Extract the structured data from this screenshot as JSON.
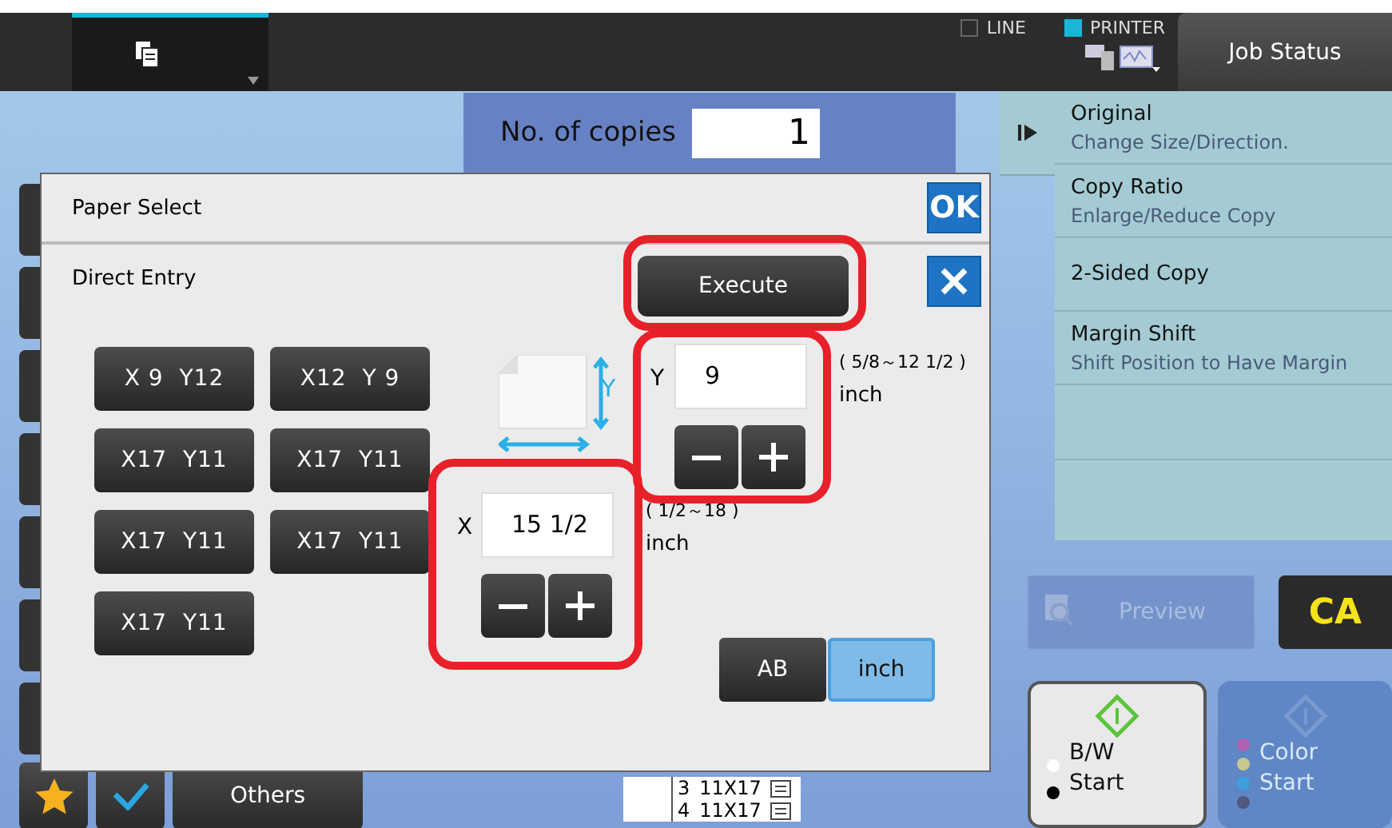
{
  "top_bar": {
    "indicators": [
      {
        "label": "LINE",
        "on": false
      },
      {
        "label": "PRINTER",
        "on": true
      }
    ],
    "job_status": "Job Status"
  },
  "copies": {
    "label": "No. of copies",
    "value": "1"
  },
  "side_panel": {
    "items": [
      {
        "title": "Original",
        "subtitle": "Change Size/Direction."
      },
      {
        "title": "Copy Ratio",
        "subtitle": "Enlarge/Reduce Copy"
      },
      {
        "title": "2-Sided Copy"
      },
      {
        "title": "Margin Shift",
        "subtitle": "Shift Position to Have Margin"
      }
    ]
  },
  "preview": {
    "label": "Preview",
    "disabled": true
  },
  "clear": "CA",
  "start_buttons": [
    {
      "kind": "bw",
      "lines": [
        "B/W",
        "Start"
      ],
      "disabled": false,
      "dots": [
        {
          "color": "#ffffff"
        },
        {
          "color": "#000000"
        }
      ]
    },
    {
      "kind": "color",
      "lines": [
        "Color",
        "Start"
      ],
      "disabled": true,
      "dots": [
        {
          "color": "#b060b0"
        },
        {
          "color": "#c8c890"
        },
        {
          "color": "#3aa0e0"
        },
        {
          "color": "#505880"
        }
      ]
    }
  ],
  "bottom_bar": {
    "others": "Others"
  },
  "tray_list": [
    {
      "number": "3",
      "size": "11X17"
    },
    {
      "number": "4",
      "size": "11X17"
    }
  ],
  "dialog": {
    "title": "Paper Select",
    "ok": "OK",
    "section": "Direct Entry",
    "execute": "Execute",
    "presets": [
      {
        "label": "X 9  Y12"
      },
      {
        "label": "X12  Y 9"
      },
      {
        "label": "X17  Y11"
      },
      {
        "label": "X17  Y11"
      },
      {
        "label": "X17  Y11"
      },
      {
        "label": "X17  Y11"
      },
      {
        "label": "X17  Y11"
      }
    ],
    "diagram_label": "Y",
    "y_field": {
      "label": "Y",
      "value": "9",
      "range": "( 5/8～12 1/2 )",
      "unit": "inch"
    },
    "x_field": {
      "label": "X",
      "value": "15 1/2",
      "range": "( 1/2～18 )",
      "unit": "inch"
    },
    "units": [
      {
        "label": "AB",
        "selected": false
      },
      {
        "label": "inch",
        "selected": true
      }
    ]
  }
}
